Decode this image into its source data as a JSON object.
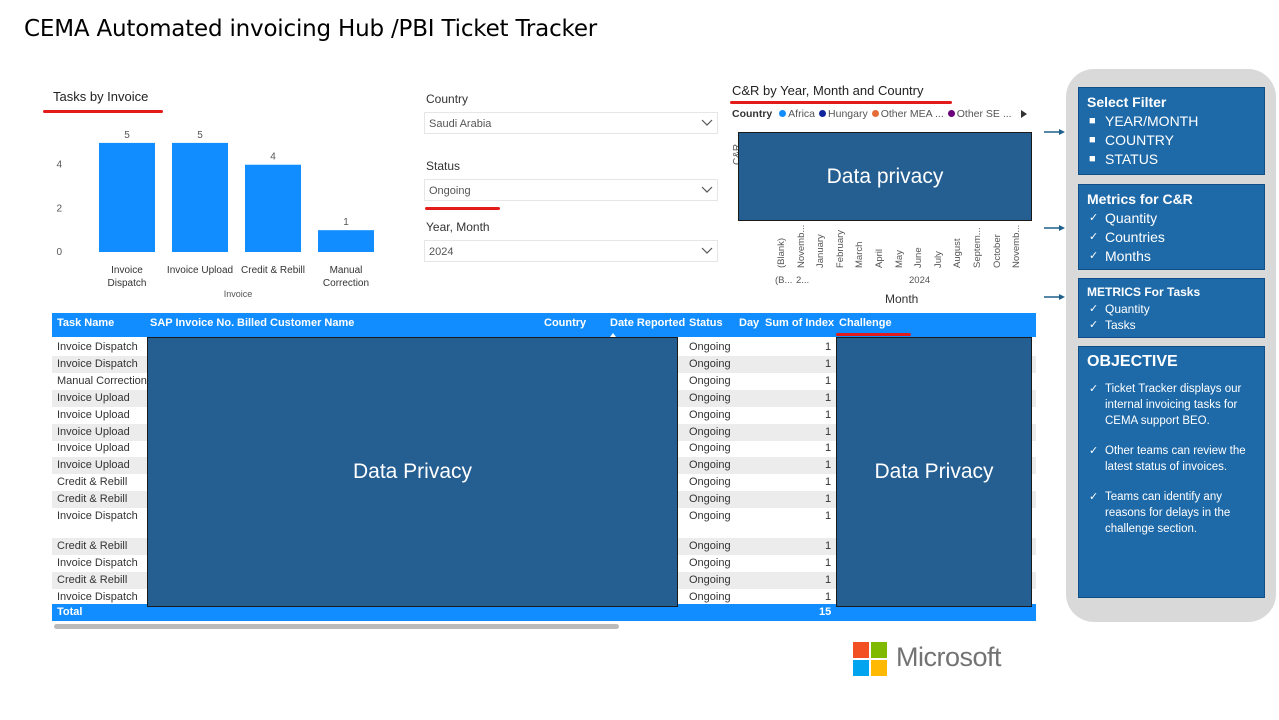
{
  "page": {
    "title": "CEMA Automated invoicing Hub /PBI Ticket Tracker"
  },
  "tasks_chart": {
    "title": "Tasks by Invoice",
    "x_label": "Invoice",
    "accent": "#118dff"
  },
  "chart_data": {
    "type": "bar",
    "title": "Tasks by Invoice",
    "xlabel": "Invoice",
    "ylabel": "",
    "categories": [
      "Invoice Dispatch",
      "Invoice Upload",
      "Credit & Rebill",
      "Manual Correction"
    ],
    "category_lines": [
      [
        "Invoice",
        "Dispatch"
      ],
      [
        "Invoice Upload"
      ],
      [
        "Credit & Rebill"
      ],
      [
        "Manual",
        "Correction"
      ]
    ],
    "values": [
      5,
      5,
      4,
      1
    ],
    "yticks": [
      0,
      2,
      4
    ],
    "ylim": [
      0,
      5.5
    ],
    "grid": false,
    "color": "#118dff"
  },
  "filters": {
    "country": {
      "label": "Country",
      "value": "Saudi Arabia"
    },
    "status": {
      "label": "Status",
      "value": "Ongoing"
    },
    "year_month": {
      "label": "Year, Month",
      "value": "2024"
    }
  },
  "cr_visual": {
    "title": "C&R by Year, Month and Country",
    "legend_title": "Country",
    "legend": [
      {
        "label": "Africa",
        "color": "#118dff"
      },
      {
        "label": "Hungary",
        "color": "#12239e"
      },
      {
        "label": "Other MEA ...",
        "color": "#e66c37"
      },
      {
        "label": "Other SE ...",
        "color": "#6b007b"
      }
    ],
    "privacy_text": "Data privacy",
    "y_label_partial": "C&R",
    "months": [
      "(Blank)",
      "Novemb...",
      "January",
      "February",
      "March",
      "April",
      "May",
      "June",
      "July",
      "August",
      "Septem...",
      "October",
      "Novemb..."
    ],
    "year_blank": "(B...",
    "year_blank2": "2...",
    "year": "2024",
    "x_title": "Month"
  },
  "table": {
    "columns": [
      "Task Name",
      "SAP Invoice No.",
      "Billed Customer Name",
      "Country",
      "Date Reported",
      "Status",
      "Day",
      "Sum of Index",
      "Challenge"
    ],
    "rows": [
      {
        "task": "Invoice Dispatch",
        "status": "Ongoing",
        "index": "1"
      },
      {
        "task": "Invoice Dispatch",
        "status": "Ongoing",
        "index": "1"
      },
      {
        "task": "Manual Correction",
        "status": "Ongoing",
        "index": "1"
      },
      {
        "task": "Invoice Upload",
        "status": "Ongoing",
        "index": "1"
      },
      {
        "task": "Invoice Upload",
        "status": "Ongoing",
        "index": "1"
      },
      {
        "task": "Invoice Upload",
        "status": "Ongoing",
        "index": "1"
      },
      {
        "task": "Invoice Upload",
        "status": "Ongoing",
        "index": "1"
      },
      {
        "task": "Invoice Upload",
        "status": "Ongoing",
        "index": "1"
      },
      {
        "task": "Credit & Rebill",
        "status": "Ongoing",
        "index": "1"
      },
      {
        "task": "Credit & Rebill",
        "status": "Ongoing",
        "index": "1"
      },
      {
        "task": "Invoice Dispatch",
        "status": "Ongoing",
        "index": "1"
      },
      {
        "task": "Credit & Rebill",
        "status": "Ongoing",
        "index": "1"
      },
      {
        "task": "Invoice Dispatch",
        "status": "Ongoing",
        "index": "1"
      },
      {
        "task": "Credit & Rebill",
        "status": "Ongoing",
        "index": "1"
      },
      {
        "task": "Invoice Dispatch",
        "status": "Ongoing",
        "index": "1"
      }
    ],
    "total_label": "Total",
    "total_value": "15",
    "privacy_left": "Data Privacy",
    "privacy_right": "Data Privacy"
  },
  "panel": {
    "filter": {
      "title": "Select Filter",
      "items": [
        "YEAR/MONTH",
        "COUNTRY",
        "STATUS"
      ]
    },
    "metrics_cr": {
      "title": "Metrics for C&R",
      "items": [
        "Quantity",
        "Countries",
        "Months"
      ]
    },
    "metrics_tasks": {
      "title": "METRICS For Tasks",
      "items": [
        "Quantity",
        "Tasks"
      ]
    },
    "objective": {
      "title": "OBJECTIVE",
      "items": [
        "Ticket Tracker displays our internal invoicing tasks for  CEMA support BEO.",
        "Other teams can review the latest status of invoices.",
        "Teams can identify any reasons for delays in the challenge section."
      ]
    }
  },
  "brand": {
    "name": "Microsoft"
  }
}
